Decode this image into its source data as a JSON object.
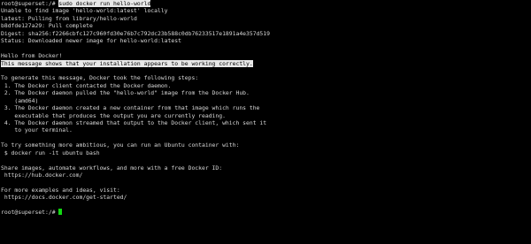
{
  "colors": {
    "background": "#000000",
    "text": "#d9d9d9",
    "highlight_bg": "#e8e8e8",
    "cursor": "#12d812"
  },
  "terminal": {
    "command_prompt": "root@superset:/# ",
    "command": "sudo docker run hello-world",
    "output": {
      "line1": "Unable to find image 'hello-world:latest' locally",
      "line2": "latest: Pulling from library/hello-world",
      "line3": "b8dfde127a29: Pull complete",
      "line4": "Digest: sha256:f2266cbfc127c960fd30e76b7c792dc23b588c0db76233517e1891a4e357d519",
      "line5": "Status: Downloaded newer image for hello-world:latest",
      "line7": "Hello from Docker!",
      "line8": "This message shows that your installation appears to be working correctly.",
      "line10": "To generate this message, Docker took the following steps:",
      "line11": " 1. The Docker client contacted the Docker daemon.",
      "line12": " 2. The Docker daemon pulled the \"hello-world\" image from the Docker Hub.",
      "line13": "    (amd64)",
      "line14": " 3. The Docker daemon created a new container from that image which runs the",
      "line15": "    executable that produces the output you are currently reading.",
      "line16": " 4. The Docker daemon streamed that output to the Docker client, which sent it",
      "line17": "    to your terminal.",
      "line19": "To try something more ambitious, you can run an Ubuntu container with:",
      "line20": " $ docker run -it ubuntu bash",
      "line22": "Share images, automate workflows, and more with a free Docker ID:",
      "line23": " https://hub.docker.com/",
      "line25": "For more examples and ideas, visit:",
      "line26": " https://docs.docker.com/get-started/"
    },
    "final_prompt": "root@superset:/# "
  }
}
